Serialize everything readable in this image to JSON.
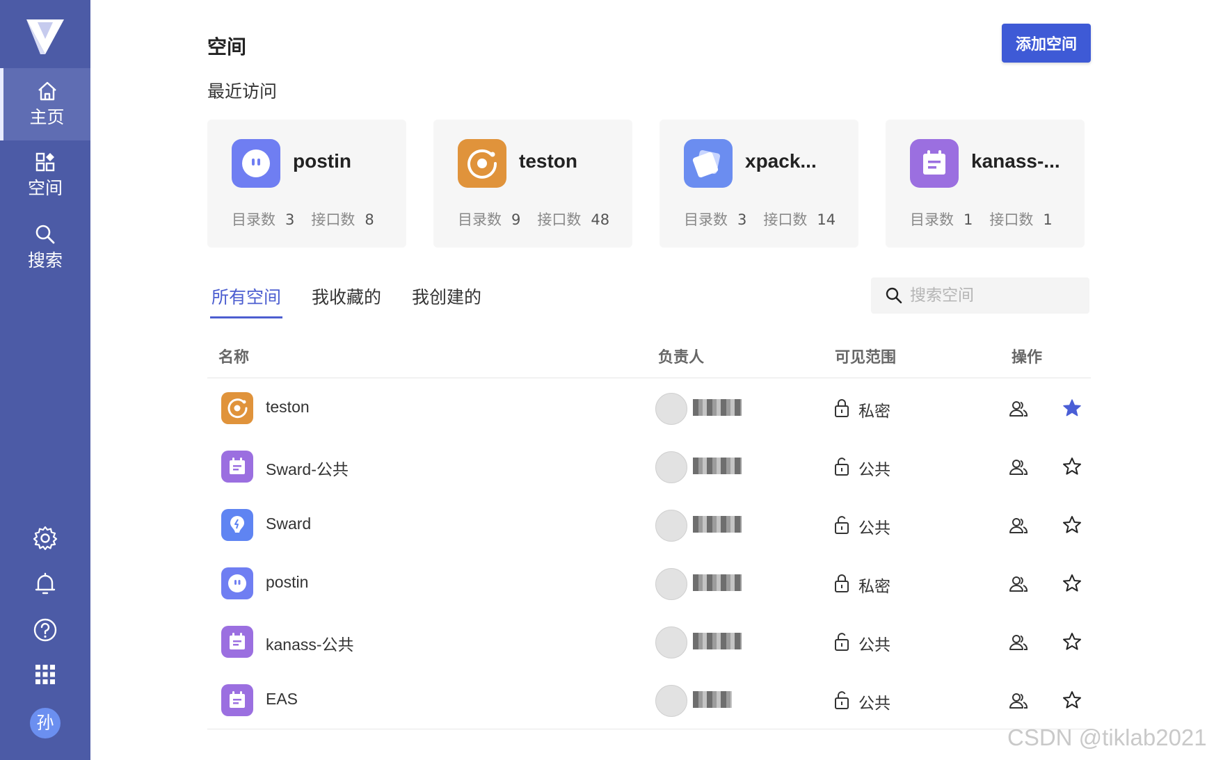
{
  "sidebar": {
    "items": [
      {
        "label": "主页",
        "icon": "home-icon",
        "active": true
      },
      {
        "label": "空间",
        "icon": "grid-icon",
        "active": false
      },
      {
        "label": "搜索",
        "icon": "search-icon",
        "active": false
      }
    ],
    "bottom_icons": [
      "settings-icon",
      "bell-icon",
      "help-icon",
      "apps-icon"
    ],
    "avatar_text": "孙",
    "bg_color": "#4c5ba6"
  },
  "header": {
    "title": "空间",
    "add_button": "添加空间"
  },
  "recent": {
    "title": "最近访问",
    "stat_dir_label": "目录数",
    "stat_api_label": "接口数",
    "cards": [
      {
        "name": "postin",
        "icon": "chat-icon",
        "color": "#6f7ef2",
        "dirs": "3",
        "apis": "8"
      },
      {
        "name": "teston",
        "icon": "target-icon",
        "color": "#e0933b",
        "dirs": "9",
        "apis": "48"
      },
      {
        "name": "xpack...",
        "icon": "cards-icon",
        "color": "#6b8df0",
        "dirs": "3",
        "apis": "14"
      },
      {
        "name": "kanass-...",
        "icon": "calendar-icon",
        "color": "#9b6fe0",
        "dirs": "1",
        "apis": "1"
      }
    ]
  },
  "tabs": [
    {
      "label": "所有空间",
      "active": true
    },
    {
      "label": "我收藏的",
      "active": false
    },
    {
      "label": "我创建的",
      "active": false
    }
  ],
  "search": {
    "placeholder": "搜索空间"
  },
  "table": {
    "headers": [
      "名称",
      "负责人",
      "可见范围",
      "操作"
    ],
    "rows": [
      {
        "name": "teston",
        "icon": "target-icon",
        "color": "#e0933b",
        "visibility": "私密",
        "locked": true,
        "favorited": true
      },
      {
        "name": "Sward-公共",
        "icon": "calendar-icon",
        "color": "#9b6fe0",
        "visibility": "公共",
        "locked": false,
        "favorited": false
      },
      {
        "name": "Sward",
        "icon": "bulb-icon",
        "color": "#5f84f2",
        "visibility": "公共",
        "locked": false,
        "favorited": false
      },
      {
        "name": "postin",
        "icon": "chat-icon",
        "color": "#6f7ef2",
        "visibility": "私密",
        "locked": true,
        "favorited": false
      },
      {
        "name": "kanass-公共",
        "icon": "calendar-icon",
        "color": "#9b6fe0",
        "visibility": "公共",
        "locked": false,
        "favorited": false
      },
      {
        "name": "EAS",
        "icon": "calendar-icon",
        "color": "#9b6fe0",
        "visibility": "公共",
        "locked": false,
        "favorited": false
      }
    ]
  },
  "colors": {
    "accent": "#4c5ed0",
    "button": "#3e5ad6",
    "star_active": "#4a5ed6"
  },
  "watermark": "CSDN @tiklab2021"
}
